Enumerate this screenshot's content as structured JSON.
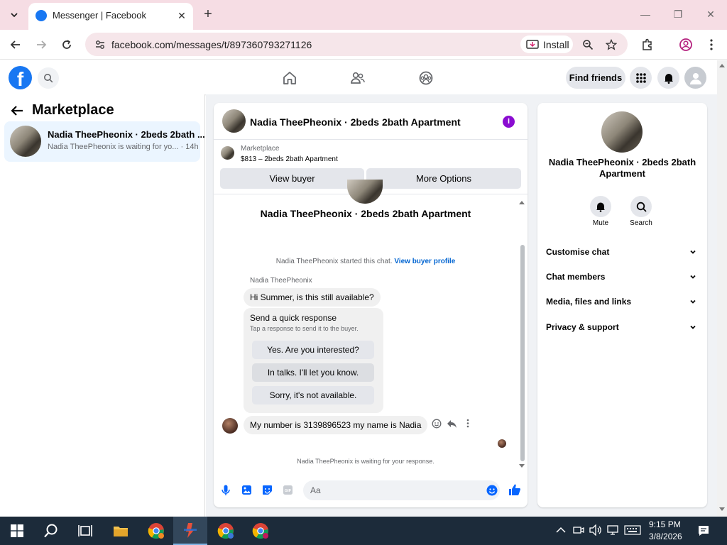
{
  "browser": {
    "tab_title": "Messenger | Facebook",
    "url": "facebook.com/messages/t/897360793271126",
    "install_label": "Install"
  },
  "header": {
    "find_friends": "Find friends"
  },
  "left": {
    "title": "Marketplace",
    "conversation": {
      "name": "Nadia TheePheonix · 2beds 2bath ...",
      "preview": "Nadia TheePheonix is waiting for yo... · 14h"
    }
  },
  "chat": {
    "header_name": "Nadia TheePheonix · 2beds 2bath Apartment",
    "info_glyph": "i",
    "marketplace_label": "Marketplace",
    "listing": "$813 – 2beds 2bath Apartment",
    "view_buyer": "View buyer",
    "more_options": "More Options",
    "convo_title": "Nadia TheePheonix · 2beds 2bath Apartment",
    "started_text": "Nadia TheePheonix started this chat.",
    "view_buyer_profile": "View buyer profile",
    "sender_label": "Nadia TheePheonix",
    "msg1": "Hi Summer, is this still available?",
    "quick_title": "Send a quick response",
    "quick_sub": "Tap a response to send it to the buyer.",
    "quick_replies": [
      "Yes. Are you interested?",
      "In talks. I'll let you know.",
      "Sorry, it's not available."
    ],
    "msg2": "My number is 3139896523 my name is Nadia",
    "waiting": "Nadia TheePheonix is waiting for your response.",
    "input_placeholder": "Aa"
  },
  "right": {
    "name": "Nadia TheePheonix · 2beds 2bath Apartment",
    "mute": "Mute",
    "search": "Search",
    "rows": [
      "Customise chat",
      "Chat members",
      "Media, files and links",
      "Privacy & support"
    ]
  },
  "taskbar": {
    "time": "9:15 PM",
    "date": "3/8/2026"
  },
  "colors": {
    "brand": "#1877f2",
    "tabstrip": "#f6dde4",
    "accent_purple": "#8a0cd1",
    "taskbar": "#1c2b3a"
  }
}
